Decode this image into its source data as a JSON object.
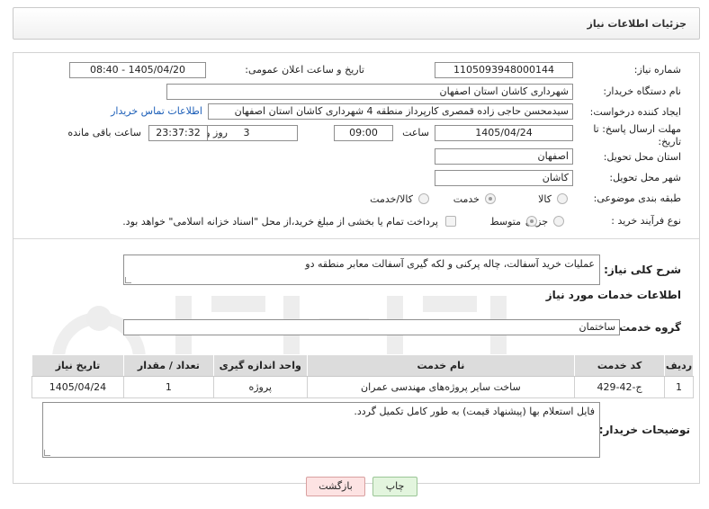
{
  "header": {
    "title": "جزئیات اطلاعات نیاز"
  },
  "form": {
    "need_number_label": "شماره نیاز:",
    "need_number": "1105093948000144",
    "announce_label": "تاریخ و ساعت اعلان عمومی:",
    "announce_value": "1405/04/20 - 08:40",
    "buyer_org_label": "نام دستگاه خریدار:",
    "buyer_org": "شهرداری کاشان استان اصفهان",
    "creator_label": "ایجاد کننده درخواست:",
    "creator": "سیدمحسن حاجی زاده قمصری کارپرداز منطقه 4 شهرداری کاشان استان اصفهان",
    "contact_link": "اطلاعات تماس خریدار",
    "deadline_label": "مهلت ارسال پاسخ: تا تاریخ:",
    "deadline_date": "1405/04/24",
    "time_label": "ساعت",
    "deadline_time": "09:00",
    "days_value": "3",
    "days_label": "روز و",
    "remaining_time": "23:37:32",
    "remaining_label": "ساعت باقی مانده",
    "province_label": "استان محل تحویل:",
    "province": "اصفهان",
    "city_label": "شهر محل تحویل:",
    "city": "کاشان",
    "category_label": "طبقه بندی موضوعی:",
    "category_options": [
      "کالا",
      "خدمت",
      "کالا/خدمت"
    ],
    "category_selected": "خدمت",
    "process_label": "نوع فرآیند خرید :",
    "process_options": [
      "جزیی",
      "متوسط"
    ],
    "process_selected": "متوسط",
    "payment_note": "پرداخت تمام یا بخشی از مبلغ خرید،از محل \"اسناد خزانه اسلامی\" خواهد بود."
  },
  "description": {
    "label": "شرح کلی نیاز:",
    "value": "عملیات خرید آسفالت، چاله پرکنی و لکه گیری آسفالت معابر منطقه دو"
  },
  "services": {
    "section_title": "اطلاعات خدمات مورد نیاز",
    "group_label": "گروه خدمت:",
    "group_value": "ساختمان",
    "columns": [
      "ردیف",
      "کد خدمت",
      "نام خدمت",
      "واحد اندازه گیری",
      "تعداد / مقدار",
      "تاریخ نیاز"
    ],
    "rows": [
      [
        "1",
        "ج-42-429",
        "ساخت سایر پروژه‌های مهندسی عمران",
        "پروژه",
        "1",
        "1405/04/24"
      ]
    ]
  },
  "buyer_notes": {
    "label": "توضیحات خریدار:",
    "value": "فایل استعلام بها (پیشنهاد قیمت) به طور کامل تکمیل گردد."
  },
  "buttons": {
    "print": "چاپ",
    "back": "بازگشت"
  },
  "colors": {
    "link": "#1d5fb8",
    "header_bg": "#dcdcdc",
    "back_btn": "#fde3e3",
    "print_btn": "#e3f5de"
  }
}
